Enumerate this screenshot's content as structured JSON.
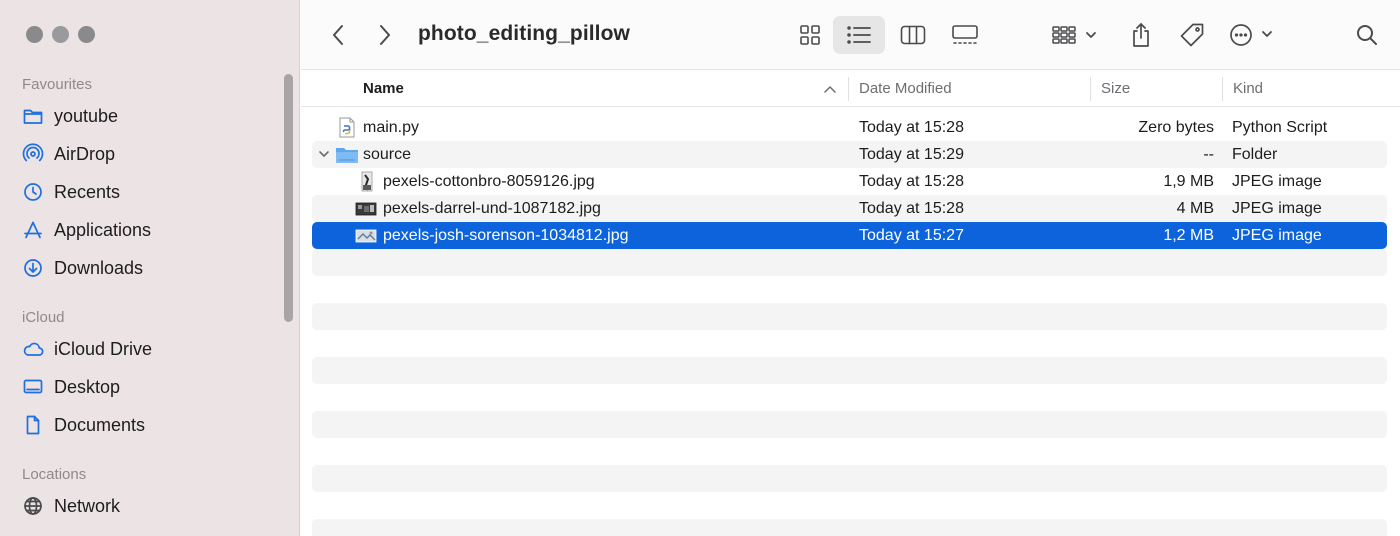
{
  "toolbar": {
    "title": "photo_editing_pillow",
    "icons": [
      "back-icon",
      "forward-icon",
      "icon-view-icon",
      "list-view-icon",
      "column-view-icon",
      "gallery-view-icon",
      "group-icon",
      "share-icon",
      "tag-icon",
      "more-icon",
      "search-icon"
    ]
  },
  "sidebar": {
    "favourites_label": "Favourites",
    "icloud_label": "iCloud",
    "locations_label": "Locations",
    "favourites": [
      {
        "label": "youtube",
        "icon": "folder-icon"
      },
      {
        "label": "AirDrop",
        "icon": "airdrop-icon"
      },
      {
        "label": "Recents",
        "icon": "clock-icon"
      },
      {
        "label": "Applications",
        "icon": "applications-icon"
      },
      {
        "label": "Downloads",
        "icon": "download-icon"
      }
    ],
    "icloud": [
      {
        "label": "iCloud Drive",
        "icon": "cloud-icon"
      },
      {
        "label": "Desktop",
        "icon": "desktop-icon"
      },
      {
        "label": "Documents",
        "icon": "document-icon"
      }
    ],
    "locations": [
      {
        "label": "Network",
        "icon": "globe-icon"
      }
    ]
  },
  "columns": {
    "name": "Name",
    "date": "Date Modified",
    "size": "Size",
    "kind": "Kind"
  },
  "files": [
    {
      "name": "main.py",
      "date": "Today at 15:28",
      "size": "Zero bytes",
      "kind": "Python Script",
      "icon": "python-file-icon"
    },
    {
      "name": "source",
      "date": "Today at 15:29",
      "size": "--",
      "kind": "Folder",
      "icon": "folder-icon",
      "expanded": true
    },
    {
      "name": "pexels-cottonbro-8059126.jpg",
      "date": "Today at 15:28",
      "size": "1,9 MB",
      "kind": "JPEG image",
      "icon": "image-thumbnail-icon"
    },
    {
      "name": "pexels-darrel-und-1087182.jpg",
      "date": "Today at 15:28",
      "size": "4 MB",
      "kind": "JPEG image",
      "icon": "image-thumbnail-icon"
    },
    {
      "name": "pexels-josh-sorenson-1034812.jpg",
      "date": "Today at 15:27",
      "size": "1,2 MB",
      "kind": "JPEG image",
      "icon": "image-thumbnail-icon",
      "selected": true
    }
  ],
  "colors": {
    "selection": "#0c63dc",
    "sidebar_icon": "#1f6fe0",
    "sidebar_bg": "#ebe3e4"
  }
}
